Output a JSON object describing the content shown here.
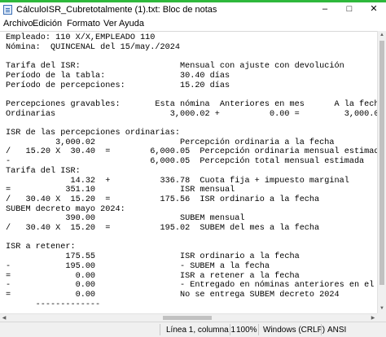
{
  "window": {
    "title": "CálculoISR_Cubretotalmente (1).txt: Bloc de notas"
  },
  "controls": {
    "minimize": "–",
    "maximize": "□",
    "close": "✕"
  },
  "menu": [
    "Archivo",
    "Edición",
    "Formato",
    "Ver",
    "Ayuda"
  ],
  "document": {
    "lines": [
      "Empleado: 110 X/X,EMPLEADO 110",
      "Nómina:  QUINCENAL del 15/may./2024",
      "",
      "Tarifa del ISR:                    Mensual con ajuste con devolución",
      "Período de la tabla:               30.40 días",
      "Período de percepciones:           15.20 días",
      "",
      "Percepciones gravables:       Esta nómina  Anteriores en mes      A la fecha",
      "Ordinarias                       3,000.02 +          0.00 =         3,000.02",
      "",
      "ISR de las percepciones ordinarias:",
      "          3,000.02                 Percepción ordinaria a la fecha",
      "/   15.20 X  30.40  =        6,000.05  Percepción ordinaria mensual estimada",
      "-                            6,000.05  Percepción total mensual estimada",
      "Tarifa del ISR:",
      "             14.32  +          336.78  Cuota fija + impuesto marginal",
      "=           351.10                 ISR mensual",
      "/   30.40 X  15.20  =          175.56  ISR ordinario a la fecha",
      "SUBEM decreto mayo 2024:",
      "            390.00                 SUBEM mensual",
      "/   30.40 X  15.20  =          195.02  SUBEM del mes a la fecha",
      "",
      "ISR a retener:",
      "            175.55                 ISR ordinario a la fecha",
      "-           195.00                 - SUBEM a la fecha",
      "=             0.00                 ISR a retener a la fecha",
      "-             0.00                 - Entregado en nóminas anteriores en el mes",
      "=             0.00                 No se entrega SUBEM decreto 2024",
      "      -------------"
    ]
  },
  "status": {
    "position": "Línea 1, columna 1",
    "zoom": "100%",
    "line_ending": "Windows (CRLF)",
    "encoding": "ANSI"
  }
}
